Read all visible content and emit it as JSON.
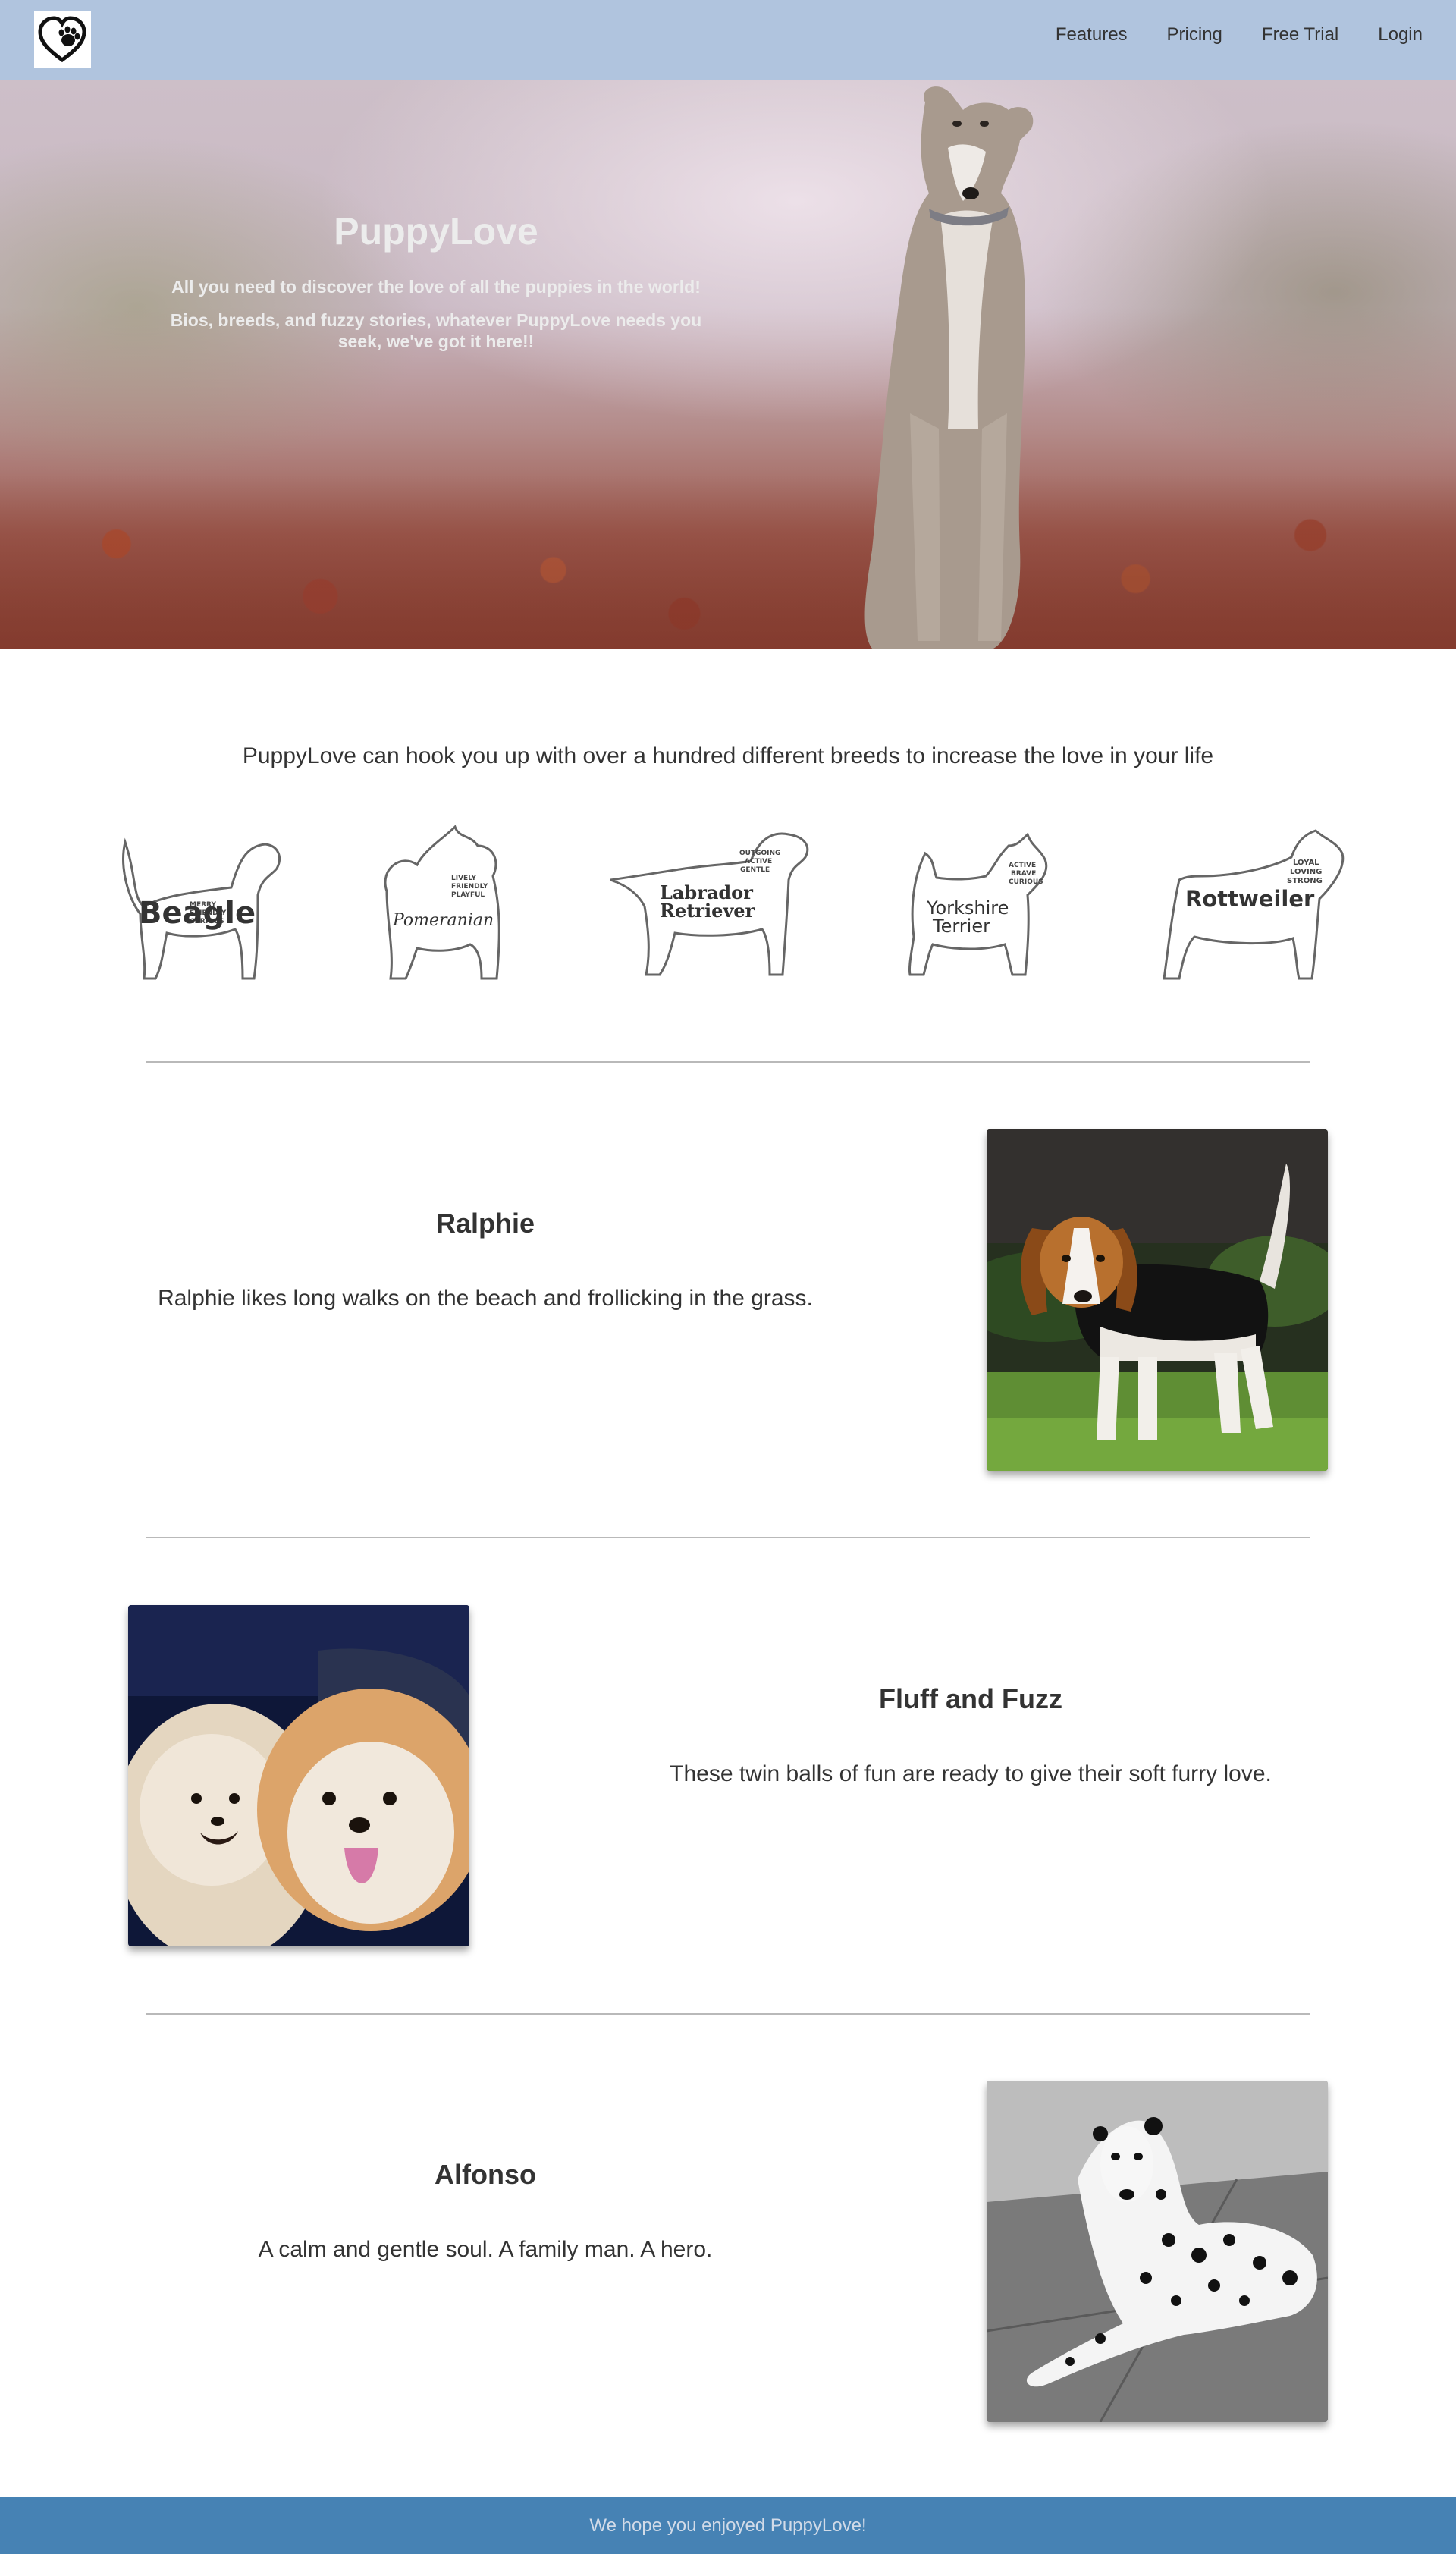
{
  "nav": {
    "items": [
      {
        "label": "Features"
      },
      {
        "label": "Pricing"
      },
      {
        "label": "Free Trial"
      },
      {
        "label": "Login"
      }
    ]
  },
  "hero": {
    "title": "PuppyLove",
    "line1": "All you need to discover the love of all the puppies in the world!",
    "line2": "Bios, breeds, and fuzzy stories, whatever PuppyLove needs you seek, we've got it here!!"
  },
  "breeds": {
    "intro": "PuppyLove can hook you up with over a hundred different breeds to increase the love in your life",
    "items": [
      {
        "name": "Beagle",
        "traits": [
          "MERRY",
          "FRIENDLY",
          "CURIOUS"
        ]
      },
      {
        "name": "Pomeranian",
        "traits": [
          "LIVELY",
          "FRIENDLY",
          "PLAYFUL"
        ]
      },
      {
        "name": "Labrador Retriever",
        "traits": [
          "OUTGOING",
          "ACTIVE",
          "GENTLE"
        ]
      },
      {
        "name": "Yorkshire Terrier",
        "traits": [
          "ACTIVE",
          "BRAVE",
          "CURIOUS"
        ]
      },
      {
        "name": "Rottweiler",
        "traits": [
          "LOYAL",
          "LOVING",
          "STRONG"
        ]
      }
    ]
  },
  "features": [
    {
      "title": "Ralphie",
      "desc": "Ralphie likes long walks on the beach and frollicking in the grass."
    },
    {
      "title": "Fluff and Fuzz",
      "desc": "These twin balls of fun are ready to give their soft furry love."
    },
    {
      "title": "Alfonso",
      "desc": "A calm and gentle soul. A family man. A hero."
    }
  ],
  "footer": {
    "text": "We hope you enjoyed PuppyLove!"
  },
  "colors": {
    "header_bg": "#b0c4de",
    "footer_bg": "#4682b4",
    "text": "#333333"
  }
}
